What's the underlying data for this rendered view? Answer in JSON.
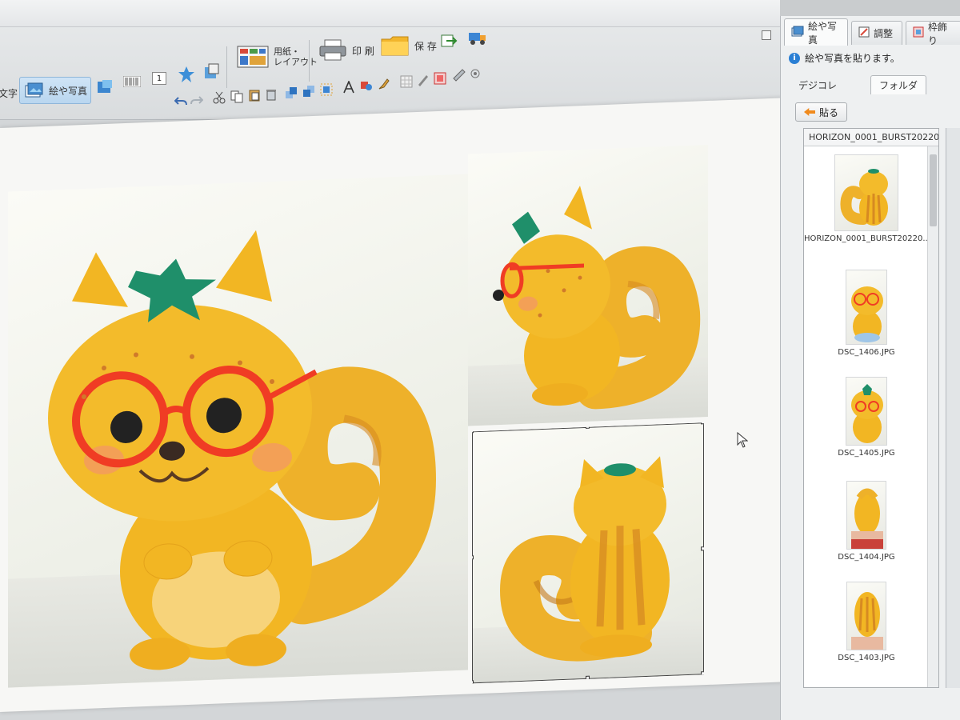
{
  "ribbon": {
    "char_label": "文字",
    "picture_label": "絵や写真",
    "paper_label": "用紙・\nレイアウト",
    "print_label": "印 刷",
    "save_label": "保 存",
    "page_number": "1"
  },
  "panel": {
    "tabs": [
      "絵や写真",
      "調整",
      "枠飾り"
    ],
    "info": "絵や写真を貼ります。",
    "subtabs": [
      "デジコレ",
      "フォルダ"
    ],
    "paste_label": "貼る",
    "list_header": "HORIZON_0001_BURST20220...",
    "thumbnails": [
      {
        "caption": "HORIZON_0001_BURST20220..."
      },
      {
        "caption": "DSC_1406.JPG"
      },
      {
        "caption": "DSC_1405.JPG"
      },
      {
        "caption": "DSC_1404.JPG"
      },
      {
        "caption": "DSC_1403.JPG"
      }
    ]
  },
  "colors": {
    "felt_yellow": "#f2b623",
    "felt_orange": "#e08a1e",
    "leaf_green": "#1f8f6a",
    "glasses_red": "#f03c24",
    "selection": "#444444",
    "active_tab": "#cfe4f6"
  },
  "icons": [
    "undo-icon",
    "redo-icon",
    "cut-icon",
    "copy-icon",
    "paste-icon",
    "delete-icon",
    "printer-icon",
    "folder-icon",
    "info-icon",
    "cursor-icon"
  ]
}
